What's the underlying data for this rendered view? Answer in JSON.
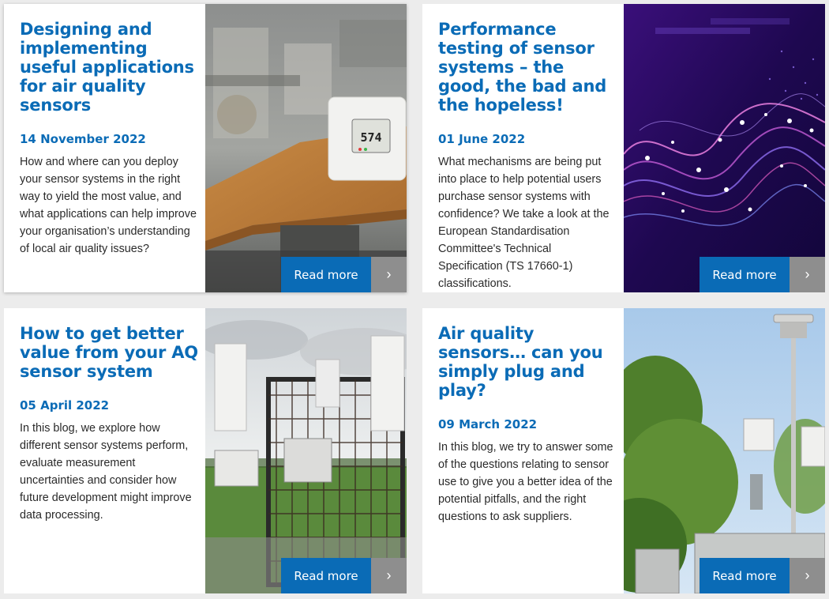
{
  "colors": {
    "accent": "#0a6bb6",
    "arrow_bg": "#8e8e8e",
    "page_bg": "#ececec",
    "card_bg": "#ffffff"
  },
  "read_more_label": "Read more",
  "arrow_icon": "chevron-right-icon",
  "cards": [
    {
      "title": "Designing and implementing useful applications for air quality sensors",
      "date": "14 November 2022",
      "excerpt": "How and where can you deploy your sensor systems in the right way to yield the most value, and what applications can help improve your organisation’s understanding of local air quality issues?",
      "image": "air-quality-sensor-on-desk",
      "display_reading": "574"
    },
    {
      "title": "Performance testing of sensor systems – the good, the bad and the hopeless!",
      "date": "01 June 2022",
      "excerpt": "What mechanisms are being put into place to help potential users purchase sensor systems with confidence? We take a look at the European Standardisation Committee's Technical Specification (TS 17660-1) classifications.",
      "image": "abstract-data-waves"
    },
    {
      "title": "How to get better value from your AQ sensor system",
      "date": "05 April 2022",
      "excerpt": "In this blog, we explore how different sensor systems perform, evaluate measurement uncertainties and consider how future development might improve data processing.",
      "image": "sensor-enclosure-field"
    },
    {
      "title": "Air quality sensors… can you simply plug and play?",
      "date": "09 March 2022",
      "excerpt": "In this blog, we try to answer some of the questions relating to sensor use to give you a better idea of the potential pitfalls, and the right questions to ask suppliers.",
      "image": "monitoring-station-trees"
    }
  ]
}
